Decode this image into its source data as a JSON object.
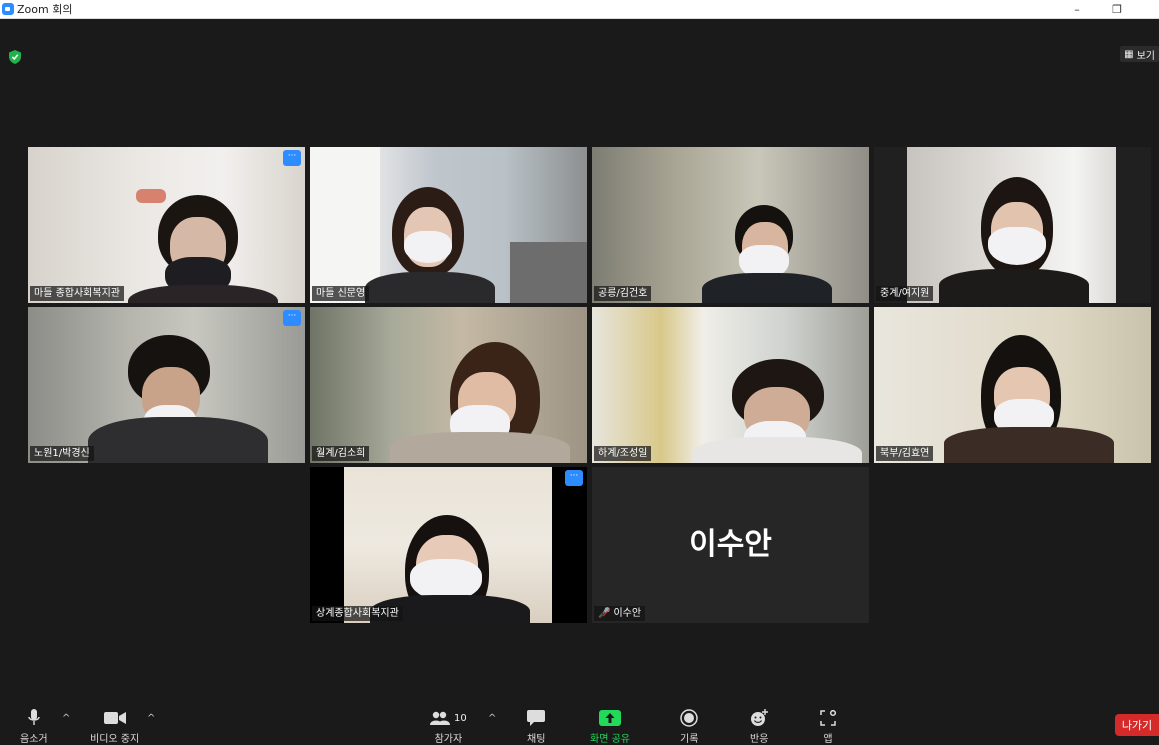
{
  "window": {
    "title": "Zoom 회의",
    "minimize": "–",
    "restore": "❐"
  },
  "view_button": {
    "label": "보기"
  },
  "tiles": [
    {
      "name": "마들 종합사회복지관",
      "active": true,
      "menu": "···"
    },
    {
      "name": "마들 신문영"
    },
    {
      "name": "공릉/김건호"
    },
    {
      "name": "중계/여지원"
    },
    {
      "name": "노원1/박경신",
      "menu": "···"
    },
    {
      "name": "월계/김소희"
    },
    {
      "name": "하계/조성일"
    },
    {
      "name": "북부/김효연"
    },
    {
      "name": "상계종합사회복지관",
      "menu": "···"
    },
    {
      "name": "이수안",
      "avatar_text": "이수안",
      "muted": true
    }
  ],
  "toolbar": {
    "mute_label": "음소거",
    "video_label": "비디오 중지",
    "participants_label": "참가자",
    "participants_count": "10",
    "chat_label": "채팅",
    "share_label": "화면 공유",
    "record_label": "기록",
    "reactions_label": "반응",
    "apps_label": "앱",
    "leave_label": "나가기"
  },
  "colors": {
    "active_border": "#c8e84a",
    "share_green": "#23d959",
    "leave_red": "#d42a2a",
    "accent_blue": "#2d8cff"
  }
}
